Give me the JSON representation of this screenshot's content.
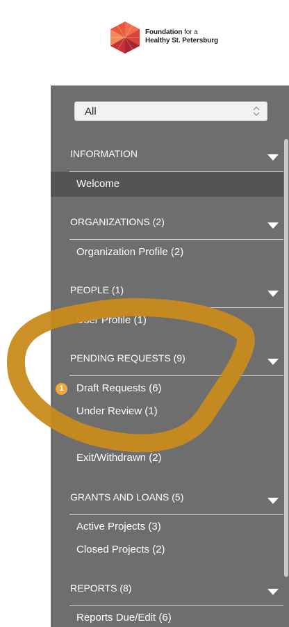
{
  "logo": {
    "line1_bold": "Foundation",
    "line1_rest": " for a",
    "line2": "Healthy St. Petersburg"
  },
  "filter": {
    "selected": "All"
  },
  "sections": [
    {
      "title": "INFORMATION",
      "items": [
        {
          "label": "Welcome",
          "active": true
        }
      ]
    },
    {
      "title": "ORGANIZATIONS (2)",
      "items": [
        {
          "label": "Organization Profile  (2)"
        }
      ]
    },
    {
      "title": "PEOPLE (1)",
      "items": [
        {
          "label": "User Profile  (1)"
        }
      ]
    },
    {
      "title": "PENDING REQUESTS (9)",
      "items": [
        {
          "label": "Draft Requests  (6)",
          "badge": "1"
        },
        {
          "label": "Under Review  (1)"
        },
        {
          "label": "Exit/Withdrawn  (2)"
        }
      ]
    },
    {
      "title": "GRANTS AND LOANS (5)",
      "items": [
        {
          "label": "Active Projects  (3)"
        },
        {
          "label": "Closed Projects  (2)"
        }
      ]
    },
    {
      "title": "REPORTS (8)",
      "items": [
        {
          "label": "Reports Due/Edit  (6)"
        }
      ]
    }
  ],
  "colors": {
    "sidebar_bg": "#6e6e6e",
    "active_item_bg": "#545454",
    "badge": "#f0a83c",
    "annotation_stroke": "#c98a1c"
  },
  "icons": {
    "logo": "foundation-hexagon-logo",
    "select": "chevron-up-down-icon",
    "section_toggle": "caret-down-icon"
  }
}
